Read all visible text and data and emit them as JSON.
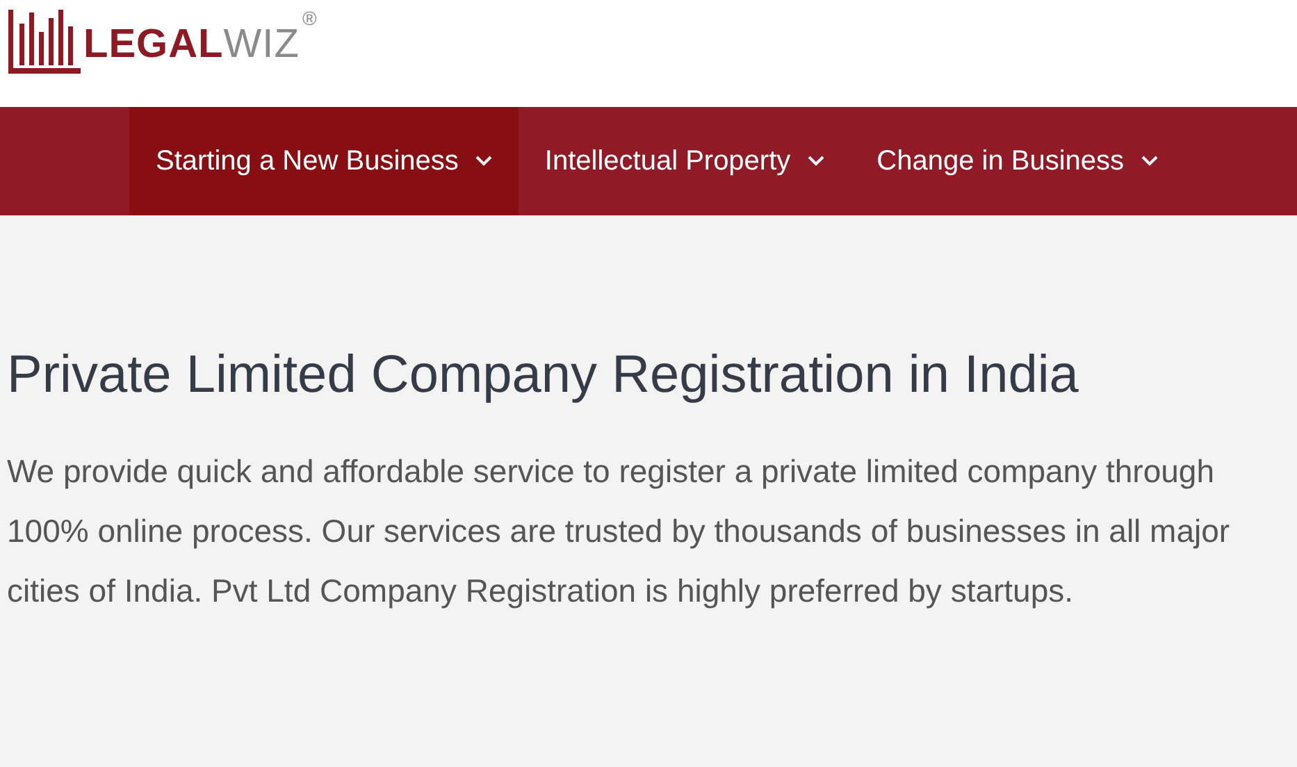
{
  "logo": {
    "strong": "LEGAL",
    "light": "WIZ",
    "mark": "®"
  },
  "nav": [
    {
      "label": "Starting a New Business",
      "selected": true
    },
    {
      "label": "Intellectual Property",
      "selected": false
    },
    {
      "label": "Change in Business",
      "selected": false
    }
  ],
  "hero": {
    "title": "Private Limited Company Registration in India",
    "text": "We provide quick and affordable service to register a private limited company through 100% online process. Our services are trusted by thousands of businesses in all major cities of India. Pvt Ltd Company Registration is highly preferred by startups."
  }
}
